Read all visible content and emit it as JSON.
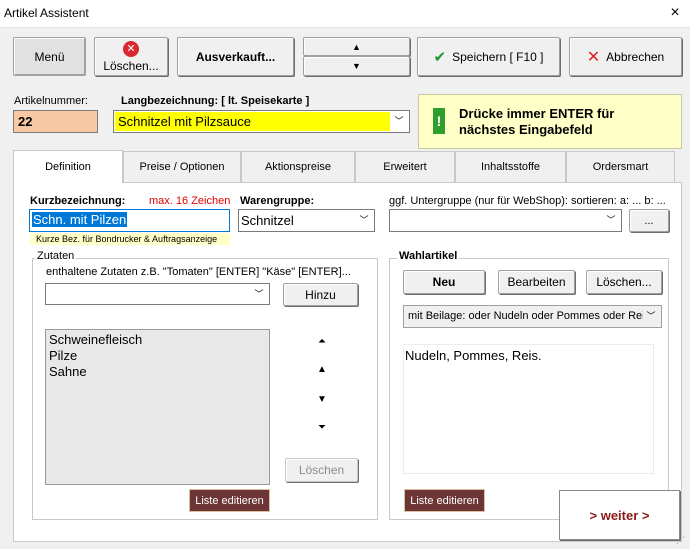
{
  "window": {
    "title": "Artikel Assistent",
    "close_icon": "×"
  },
  "toolbar": {
    "menu_label": "Menü",
    "delete_label": "Löschen...",
    "soldout_label": "Ausverkauft...",
    "up_icon": "▲",
    "down_icon": "▼",
    "save_label": "Speichern [ F10 ]",
    "cancel_label": "Abbrechen"
  },
  "article": {
    "number_label": "Artikelnummer:",
    "number": "22",
    "long_label": "Langbezeichnung:  [ lt. Speisekarte ]",
    "long_value": "Schnitzel mit Pilzsauce"
  },
  "hint": {
    "icon": "!",
    "text": "Drücke immer ENTER für nächstes Eingabefeld"
  },
  "tabs": [
    {
      "label": "Definition"
    },
    {
      "label": "Preise / Optionen"
    },
    {
      "label": "Aktionspreise"
    },
    {
      "label": "Erweitert"
    },
    {
      "label": "Inhaltsstoffe"
    },
    {
      "label": "Ordersmart"
    }
  ],
  "definition": {
    "kurz_label": "Kurzbezeichnung:",
    "kurz_max": "max. 16 Zeichen",
    "kurz_value": "Schn. mit Pilzen",
    "kurz_hint": "Kurze Bez. für Bondrucker & Auftragsanzeige",
    "waren_label": "Warengruppe:",
    "waren_value": "Schnitzel",
    "unter_label": "ggf. Untergruppe (nur für WebShop): sortieren: a: ... b: ...",
    "unter_value": "",
    "unter_btn": "..."
  },
  "zutaten": {
    "legend": "Zutaten",
    "instruction": "enthaltene Zutaten z.B. \"Tomaten\" [ENTER] \"Käse\" [ENTER]...",
    "combo_value": "",
    "add_label": "Hinzu",
    "items": [
      "Schweinefleisch",
      "Pilze",
      "Sahne"
    ],
    "order_top": "⏶",
    "order_up": "▲",
    "order_down": "▼",
    "order_bottom": "⏷",
    "delete_label": "Löschen",
    "edit_list_label": "Liste editieren"
  },
  "wahlartikel": {
    "legend": "Wahlartikel",
    "new_label": "Neu",
    "edit_label": "Bearbeiten",
    "delete_label": "Löschen...",
    "select_value": "mit Beilage: oder Nudeln oder Pommes oder Reis",
    "text": "Nudeln, Pommes, Reis.",
    "edit_list_label": "Liste editieren"
  },
  "footer": {
    "next_label": "> weiter >"
  }
}
